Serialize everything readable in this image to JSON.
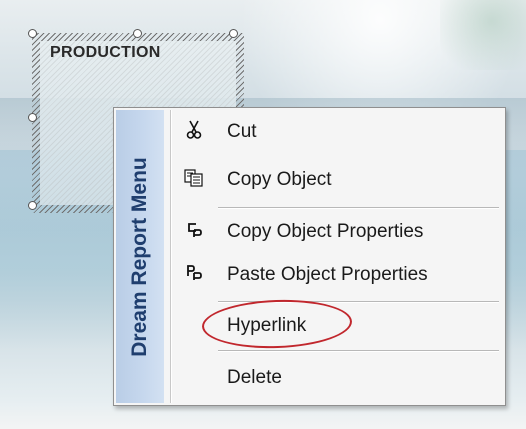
{
  "object": {
    "label": "PRODUCTION"
  },
  "context_menu": {
    "title": "Dream Report Menu",
    "items": [
      {
        "label": "Cut",
        "icon": "scissors-icon"
      },
      {
        "label": "Copy Object",
        "icon": "copy-icon"
      },
      {
        "label": "Copy Object Properties",
        "icon": "copy-properties-icon"
      },
      {
        "label": "Paste Object Properties",
        "icon": "paste-properties-icon"
      },
      {
        "label": "Hyperlink",
        "icon": ""
      },
      {
        "label": "Delete",
        "icon": ""
      }
    ],
    "highlighted_item": "Hyperlink",
    "highlight_color": "#c1272d"
  }
}
